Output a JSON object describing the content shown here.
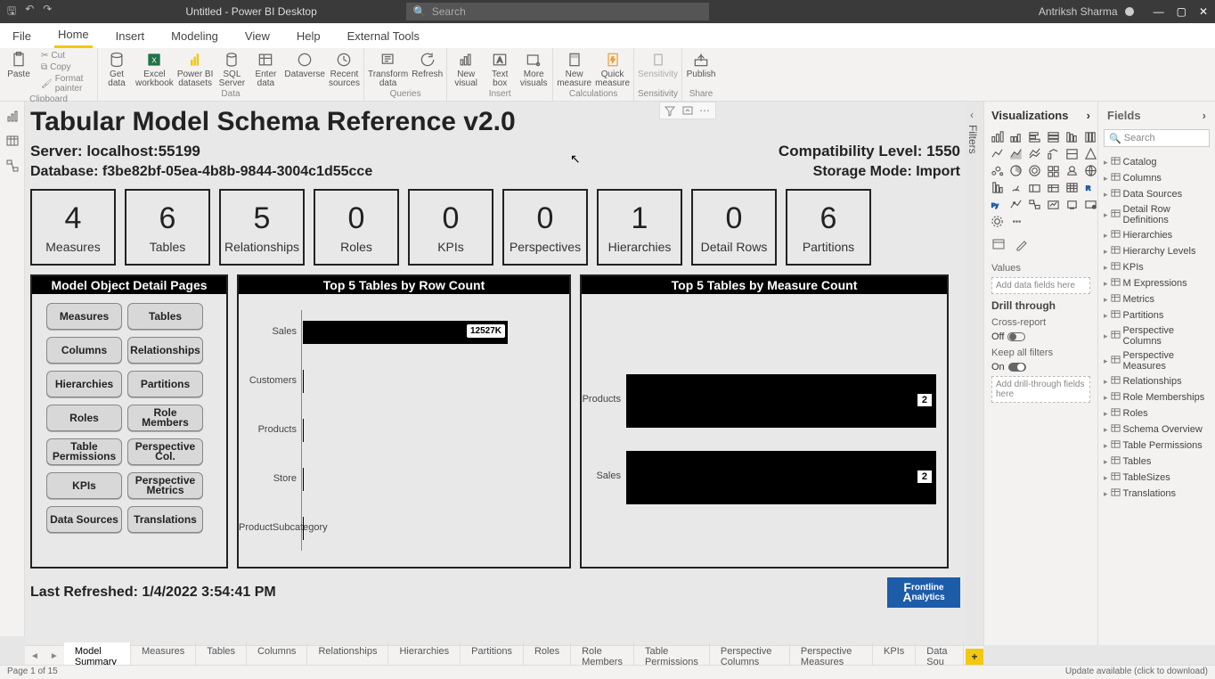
{
  "titlebar": {
    "title": "Untitled - Power BI Desktop",
    "search_placeholder": "Search",
    "user": "Antriksh Sharma"
  },
  "menu": {
    "file": "File",
    "home": "Home",
    "insert": "Insert",
    "modeling": "Modeling",
    "view": "View",
    "help": "Help",
    "external": "External Tools"
  },
  "ribbon": {
    "paste": "Paste",
    "cut": "Cut",
    "copy": "Copy",
    "format_painter": "Format painter",
    "clipboard": "Clipboard",
    "get_data": "Get\ndata",
    "excel": "Excel\nworkbook",
    "pbi_datasets": "Power BI\ndatasets",
    "sql": "SQL\nServer",
    "enter_data": "Enter\ndata",
    "dataverse": "Dataverse",
    "recent": "Recent\nsources",
    "data": "Data",
    "transform": "Transform\ndata",
    "refresh": "Refresh",
    "queries": "Queries",
    "new_visual": "New\nvisual",
    "text_box": "Text\nbox",
    "more_visuals": "More\nvisuals",
    "insert": "Insert",
    "new_measure": "New\nmeasure",
    "quick_measure": "Quick\nmeasure",
    "calculations": "Calculations",
    "sensitivity": "Sensitivity",
    "sensitivity_lbl": "Sensitivity",
    "publish": "Publish",
    "share": "Share"
  },
  "report": {
    "title": "Tabular Model Schema Reference v2.0",
    "server_label": "Server: localhost:55199",
    "compat_label": "Compatibility Level: 1550",
    "database_label": "Database: f3be82bf-05ea-4b8b-9844-3004c1d55cce",
    "storage_label": "Storage Mode: Import",
    "last_refresh": "Last Refreshed: 1/4/2022 3:54:41 PM",
    "logo1": "rontline",
    "logo2": "nalytics"
  },
  "cards": [
    {
      "n": "4",
      "l": "Measures"
    },
    {
      "n": "6",
      "l": "Tables"
    },
    {
      "n": "5",
      "l": "Relationships"
    },
    {
      "n": "0",
      "l": "Roles"
    },
    {
      "n": "0",
      "l": "KPIs"
    },
    {
      "n": "0",
      "l": "Perspectives"
    },
    {
      "n": "1",
      "l": "Hierarchies"
    },
    {
      "n": "0",
      "l": "Detail Rows"
    },
    {
      "n": "6",
      "l": "Partitions"
    }
  ],
  "links": {
    "title": "Model Object Detail Pages",
    "buttons": [
      "Measures",
      "Tables",
      "Columns",
      "Relationships",
      "Hierarchies",
      "Partitions",
      "Roles",
      "Role Members",
      "Table Permissions",
      "Perspective Col.",
      "KPIs",
      "Perspective Metrics",
      "Data Sources",
      "Translations"
    ]
  },
  "chart_data": [
    {
      "type": "bar",
      "title": "Top 5 Tables by Row Count",
      "orientation": "horizontal",
      "categories": [
        "Sales",
        "Customers",
        "Products",
        "Store",
        "ProductSubcategory"
      ],
      "values": [
        12527000,
        18000,
        2500,
        300,
        40
      ],
      "data_labels": [
        "12527K",
        "",
        "",
        "",
        ""
      ],
      "xlabel": "",
      "ylabel": ""
    },
    {
      "type": "bar",
      "title": "Top 5 Tables by Measure Count",
      "orientation": "horizontal",
      "categories": [
        "Products",
        "Sales"
      ],
      "values": [
        2,
        2
      ],
      "data_labels": [
        "2",
        "2"
      ],
      "xlabel": "",
      "ylabel": ""
    }
  ],
  "vizpane": {
    "title": "Visualizations",
    "values": "Values",
    "add_fields": "Add data fields here",
    "drill": "Drill through",
    "cross": "Cross-report",
    "off": "Off",
    "keep": "Keep all filters",
    "on": "On",
    "add_drill": "Add drill-through fields here"
  },
  "fieldspane": {
    "title": "Fields",
    "search": "Search",
    "tables": [
      "Catalog",
      "Columns",
      "Data Sources",
      "Detail Row Definitions",
      "Hierarchies",
      "Hierarchy Levels",
      "KPIs",
      "M Expressions",
      "Metrics",
      "Partitions",
      "Perspective Columns",
      "Perspective Measures",
      "Relationships",
      "Role Memberships",
      "Roles",
      "Schema Overview",
      "Table Permissions",
      "Tables",
      "TableSizes",
      "Translations"
    ]
  },
  "filters_label": "Filters",
  "pagetabs": [
    "Model Summary",
    "Measures",
    "Tables",
    "Columns",
    "Relationships",
    "Hierarchies",
    "Partitions",
    "Roles",
    "Role Members",
    "Table Permissions",
    "Perspective Columns",
    "Perspective Measures",
    "KPIs",
    "Data Sou"
  ],
  "statusbar": {
    "left": "Page 1 of 15",
    "right": "Update available (click to download)"
  }
}
